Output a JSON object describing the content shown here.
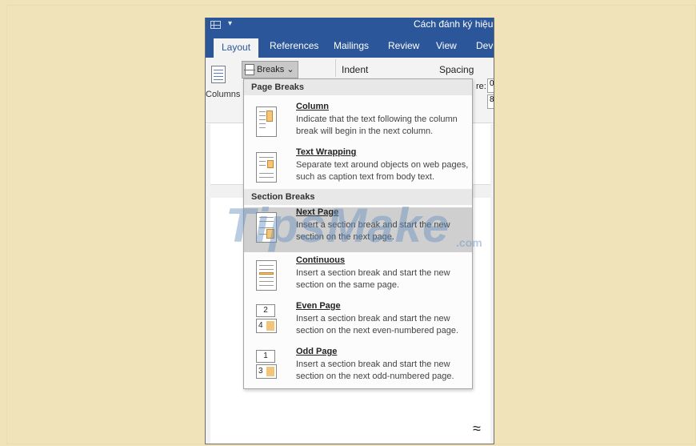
{
  "window": {
    "title": "Cách đánh ký hiệu l"
  },
  "tabs": [
    {
      "label": "Layout",
      "active": true
    },
    {
      "label": "References",
      "active": false
    },
    {
      "label": "Mailings",
      "active": false
    },
    {
      "label": "Review",
      "active": false
    },
    {
      "label": "View",
      "active": false
    },
    {
      "label": "Deve",
      "active": false
    }
  ],
  "ribbon": {
    "columns_label": "Columns",
    "breaks_label": "Breaks",
    "breaks_chevron": "⌄",
    "indent_label": "Indent",
    "spacing_label": "Spacing",
    "frag_re": "re:",
    "box1": "0",
    "box2": "8"
  },
  "menu": {
    "page_breaks_header": "Page Breaks",
    "section_breaks_header": "Section Breaks",
    "items": [
      {
        "title": "Column",
        "desc": "Indicate that the text following the column break will begin in the next column.",
        "icon": "column-break-icon"
      },
      {
        "title": "Text Wrapping",
        "desc": "Separate text around objects on web pages, such as caption text from body text.",
        "icon": "text-wrapping-break-icon"
      },
      {
        "title": "Next Page",
        "desc": "Insert a section break and start the new section on the next page.",
        "icon": "next-page-break-icon",
        "hovered": true
      },
      {
        "title": "Continuous",
        "desc": "Insert a section break and start the new section on the same page.",
        "icon": "continuous-break-icon"
      },
      {
        "title": "Even Page",
        "desc": "Insert a section break and start the new section on the next even-numbered page.",
        "icon": "even-page-break-icon",
        "num_top": "2",
        "num_bottom": "4"
      },
      {
        "title": "Odd Page",
        "desc": "Insert a section break and start the new section on the next odd-numbered page.",
        "icon": "odd-page-break-icon",
        "num_top": "1",
        "num_bottom": "3"
      }
    ]
  },
  "document": {
    "glyph": "≈"
  },
  "watermark": {
    "text": "TipsMake",
    "suffix": ".com"
  },
  "colors": {
    "background": "#f0e3b9",
    "word_blue": "#2b579a",
    "hover": "#cfcfcf",
    "icon_fill": "#f3c57a"
  }
}
